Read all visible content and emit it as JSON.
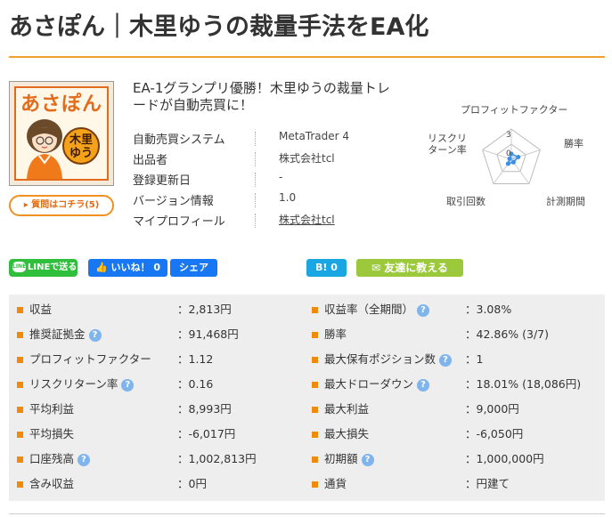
{
  "page": {
    "title": "あさぽん｜木里ゆうの裁量手法をEA化"
  },
  "thumbnail": {
    "logo_text": "あさぽん",
    "badge_text": "木里ゆう"
  },
  "question_button": "質問はコチラ(5)",
  "catchphrase": "EA-1グランプリ優勝！木里ゆうの裁量トレードが自動売買に！",
  "info": [
    {
      "key": "自動売買システム",
      "value": "MetaTrader 4"
    },
    {
      "key": "出品者",
      "value": "株式会社tcl"
    },
    {
      "key": "登録更新日",
      "value": "-"
    },
    {
      "key": "バージョン情報",
      "value": "1.0"
    },
    {
      "key": "マイプロフィール",
      "value": "株式会社tcl"
    }
  ],
  "radar": {
    "axes": [
      "プロフィットファクター",
      "勝率",
      "計測期間",
      "取引回数",
      "リスクリターン率"
    ],
    "scale_labels": [
      "3",
      "0"
    ],
    "values": [
      0.9,
      1.2,
      0.6,
      0.9,
      0.3
    ],
    "max": 5,
    "color": "#3a8ee6"
  },
  "share": {
    "line": "LINEで送る",
    "line_icon": "LINE",
    "like": "いいね！ 0",
    "fb_share": "シェア",
    "hatena": "B! 0",
    "mail": "友達に教える"
  },
  "stats_left": [
    {
      "label": "収益",
      "help": false,
      "value": "：2,813円"
    },
    {
      "label": "推奨証拠金",
      "help": true,
      "value": "：91,468円"
    },
    {
      "label": "プロフィットファクター",
      "help": false,
      "value": "：1.12"
    },
    {
      "label": "リスクリターン率",
      "help": true,
      "value": "：0.16"
    },
    {
      "label": "平均利益",
      "help": false,
      "value": "：8,993円"
    },
    {
      "label": "平均損失",
      "help": false,
      "value": "：-6,017円"
    },
    {
      "label": "口座残高",
      "help": true,
      "value": "：1,002,813円"
    },
    {
      "label": "含み収益",
      "help": false,
      "value": "：0円"
    }
  ],
  "stats_right": [
    {
      "label": "収益率（全期間）",
      "help": true,
      "value": "：3.08%"
    },
    {
      "label": "勝率",
      "help": false,
      "value": "：42.86% (3/7)"
    },
    {
      "label": "最大保有ポジション数",
      "help": true,
      "value": "：1"
    },
    {
      "label": "最大ドローダウン",
      "help": true,
      "value": "：18.01% (18,086円)"
    },
    {
      "label": "最大利益",
      "help": false,
      "value": "：9,000円"
    },
    {
      "label": "最大損失",
      "help": false,
      "value": "：-6,050円"
    },
    {
      "label": "初期額",
      "help": true,
      "value": "：1,000,000円"
    },
    {
      "label": "通貨",
      "help": false,
      "value": "：円建て"
    }
  ],
  "help_glyph": "?",
  "colors": {
    "accent": "#f0a030",
    "bullet": "#f08a0a",
    "line_green": "#2fbf3c",
    "facebook": "#1877f2",
    "hatena": "#1aa6e3",
    "mail_green": "#9cc93b",
    "help_blue": "#7fb4ec"
  }
}
